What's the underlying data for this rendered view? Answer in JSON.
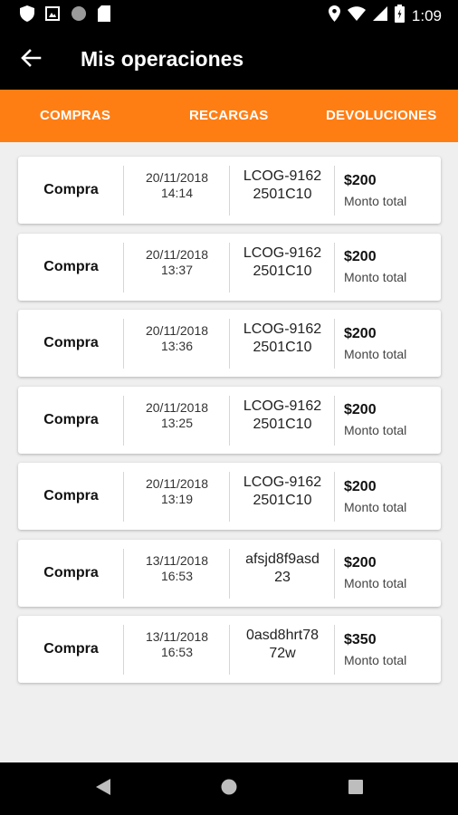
{
  "status_bar": {
    "time": "1:09",
    "left_icons": [
      "shield-icon",
      "photo-icon",
      "circle-icon",
      "sd-card-icon"
    ],
    "right_icons": [
      "location-icon",
      "wifi-icon",
      "signal-icon",
      "battery-icon"
    ]
  },
  "app_bar": {
    "title": "Mis operaciones",
    "back_icon": "arrow-left-icon"
  },
  "tabs": [
    {
      "label": "COMPRAS"
    },
    {
      "label": "RECARGAS"
    },
    {
      "label": "DEVOLUCIONES"
    }
  ],
  "colors": {
    "accent": "#ff7e14",
    "app_bar": "#000000",
    "background": "#efefef"
  },
  "operations": [
    {
      "type": "Compra",
      "date": "20/11/2018",
      "time": "14:14",
      "ref_line1": "LCOG-9162",
      "ref_line2": "2501C10",
      "amount": "$200",
      "amount_label": "Monto total"
    },
    {
      "type": "Compra",
      "date": "20/11/2018",
      "time": "13:37",
      "ref_line1": "LCOG-9162",
      "ref_line2": "2501C10",
      "amount": "$200",
      "amount_label": "Monto total"
    },
    {
      "type": "Compra",
      "date": "20/11/2018",
      "time": "13:36",
      "ref_line1": "LCOG-9162",
      "ref_line2": "2501C10",
      "amount": "$200",
      "amount_label": "Monto total"
    },
    {
      "type": "Compra",
      "date": "20/11/2018",
      "time": "13:25",
      "ref_line1": "LCOG-9162",
      "ref_line2": "2501C10",
      "amount": "$200",
      "amount_label": "Monto total"
    },
    {
      "type": "Compra",
      "date": "20/11/2018",
      "time": "13:19",
      "ref_line1": "LCOG-9162",
      "ref_line2": "2501C10",
      "amount": "$200",
      "amount_label": "Monto total"
    },
    {
      "type": "Compra",
      "date": "13/11/2018",
      "time": "16:53",
      "ref_line1": "afsjd8f9asd",
      "ref_line2": "23",
      "amount": "$200",
      "amount_label": "Monto total"
    },
    {
      "type": "Compra",
      "date": "13/11/2018",
      "time": "16:53",
      "ref_line1": "0asd8hrt78",
      "ref_line2": "72w",
      "amount": "$350",
      "amount_label": "Monto total"
    }
  ],
  "nav_bar": {
    "icons": [
      "nav-back-icon",
      "nav-home-icon",
      "nav-recent-icon"
    ]
  }
}
